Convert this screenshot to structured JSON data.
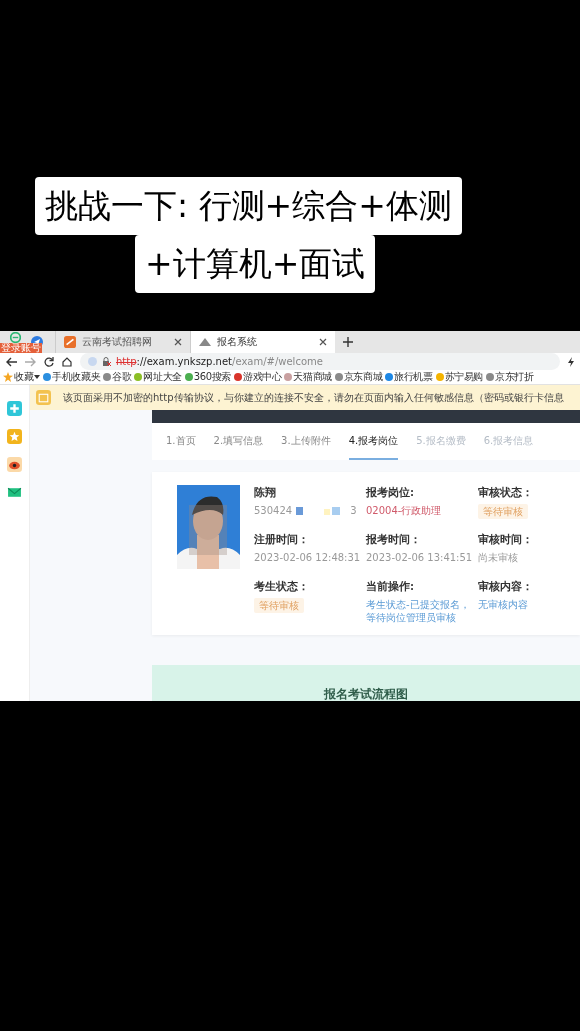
{
  "caption": [
    "挑战一下: 行测+综合+体测",
    "+计算机+面试"
  ],
  "browser": {
    "login_badge": "登录账号",
    "tabs": [
      {
        "title": "云南考试招聘网",
        "selected": false
      },
      {
        "title": "报名系统",
        "selected": true
      }
    ],
    "url": {
      "scheme": "http",
      "rest": "://exam.ynkszp.net",
      "path": "/exam/#/welcome"
    },
    "favorites": "收藏",
    "bookmarks": [
      {
        "label": "手机收藏夹",
        "color": "#2b8fe0"
      },
      {
        "label": "谷歌",
        "color": "#8a8a8a"
      },
      {
        "label": "网址大全",
        "color": "#8cbf26"
      },
      {
        "label": "360搜索",
        "color": "#4caf50"
      },
      {
        "label": "游戏中心",
        "color": "#d9342b"
      },
      {
        "label": "天猫商城",
        "color": "#c9a0a0"
      },
      {
        "label": "京东商城",
        "color": "#8a8a8a"
      },
      {
        "label": "旅行机票",
        "color": "#1e88e5"
      },
      {
        "label": "苏宁易购",
        "color": "#f5b400"
      },
      {
        "label": "京东打折",
        "color": "#8a8a8a"
      }
    ]
  },
  "notice": "该页面采用不加密的http传输协议，与你建立的连接不安全，请勿在页面内输入任何敏感信息（密码或银行卡信息",
  "steps": [
    {
      "label": "1.首页",
      "selected": false,
      "disabled": false
    },
    {
      "label": "2.填写信息",
      "selected": false,
      "disabled": false
    },
    {
      "label": "3.上传附件",
      "selected": false,
      "disabled": false
    },
    {
      "label": "4.报考岗位",
      "selected": true,
      "disabled": false
    },
    {
      "label": "5.报名缴费",
      "selected": false,
      "disabled": true
    },
    {
      "label": "6.报考信息",
      "selected": false,
      "disabled": true
    }
  ],
  "applicant": {
    "name": "陈翔",
    "id_start": "530424",
    "id_end": "3",
    "columns": [
      [
        {
          "label": "注册时间：",
          "value": "2023-02-06 12:48:31",
          "kind": "text"
        },
        {
          "label": "考生状态：",
          "value": "等待审核",
          "kind": "tag"
        }
      ],
      [
        {
          "label": "报考岗位:",
          "value": "02004-行政助理",
          "kind": "alert"
        },
        {
          "label": "报考时间：",
          "value": "2023-02-06 13:41:51",
          "kind": "text"
        },
        {
          "label": "当前操作:",
          "value": "考生状态-已提交报名，等待岗位管理员审核",
          "kind": "link"
        }
      ],
      [
        {
          "label": "审核状态：",
          "value": "等待审核",
          "kind": "tag"
        },
        {
          "label": "审核时间：",
          "value": "尚未审核",
          "kind": "text"
        },
        {
          "label": "审核内容：",
          "value": "无审核内容",
          "kind": "link"
        }
      ]
    ]
  },
  "flow_title": "报名考试流程图"
}
